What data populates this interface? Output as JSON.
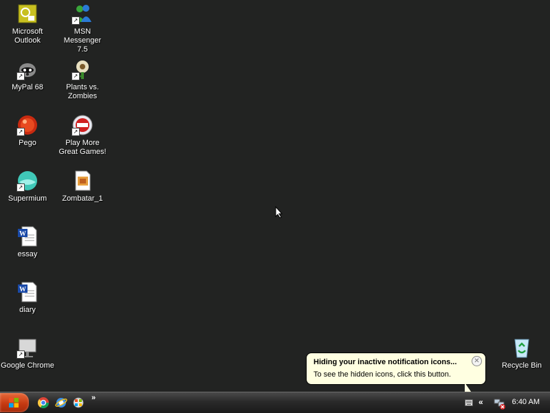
{
  "desktop": {
    "icons": [
      {
        "label": "Microsoft\nOutlook",
        "icon": "outlook-icon",
        "shortcut": false
      },
      {
        "label": "MSN Messenger\n7.5",
        "icon": "msn-messenger-icon",
        "shortcut": true
      },
      {
        "label": "MyPal 68",
        "icon": "mypal-icon",
        "shortcut": true
      },
      {
        "label": "Plants vs.\nZombies",
        "icon": "plants-vs-zombies-icon",
        "shortcut": true
      },
      {
        "label": "Pego",
        "icon": "pego-icon",
        "shortcut": true
      },
      {
        "label": "Play More\nGreat Games!",
        "icon": "popcap-icon",
        "shortcut": true
      },
      {
        "label": "Supermium",
        "icon": "supermium-icon",
        "shortcut": true
      },
      {
        "label": "Zombatar_1",
        "icon": "image-file-icon",
        "shortcut": false
      },
      {
        "label": "essay",
        "icon": "word-document-icon",
        "shortcut": false
      },
      {
        "label": "diary",
        "icon": "word-document-icon",
        "shortcut": false
      },
      {
        "label": "Google Chrome",
        "icon": "google-chrome-icon",
        "shortcut": true
      },
      {
        "label": "Recycle Bin",
        "icon": "recycle-bin-icon",
        "shortcut": false
      }
    ]
  },
  "taskbar": {
    "quick_launch": [
      "chrome-icon",
      "internet-explorer-icon",
      "windows-media-player-icon"
    ],
    "quick_launch_more": "»",
    "tray_expand": "«",
    "clock": "6:40 AM"
  },
  "balloon": {
    "title": "Hiding your inactive notification icons...",
    "text": "To see the hidden icons, click this button.",
    "close": "✕"
  },
  "colors": {
    "desktop_bg": "#222322",
    "balloon_bg": "#ffffe1",
    "start_button": "#c63a12"
  }
}
